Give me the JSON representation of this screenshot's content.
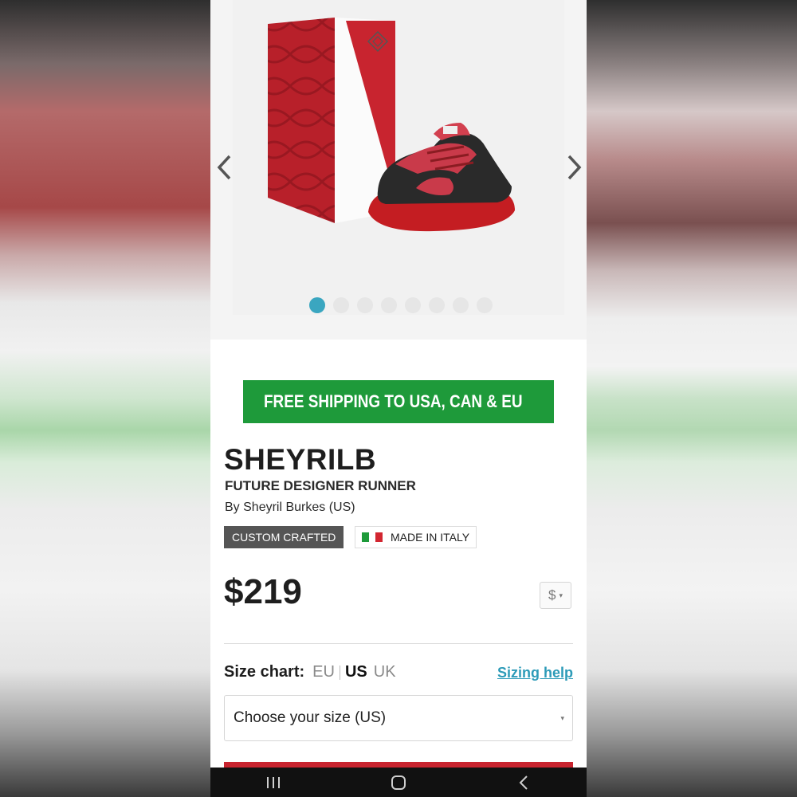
{
  "gallery": {
    "slide_count": 8,
    "active_index": 0,
    "accent_color": "#3aa6c0"
  },
  "shipping_banner": {
    "text": "FREE SHIPPING TO USA, CAN & EU",
    "icon": "airplane-icon",
    "color": "#1e9a3a"
  },
  "product": {
    "name": "SHEYRILB",
    "subtitle": "FUTURE DESIGNER RUNNER",
    "byline": "By Sheyril Burkes (US)",
    "badge_custom": "CUSTOM CRAFTED",
    "badge_origin": "MADE IN ITALY",
    "price": "$219",
    "currency": "$"
  },
  "size": {
    "chart_label": "Size chart:",
    "options": [
      "EU",
      "US",
      "UK"
    ],
    "active_option": "US",
    "help_label": "Sizing help",
    "select_placeholder": "Choose your size (US)"
  },
  "nav": {
    "icons": [
      "recent-apps-icon",
      "home-icon",
      "back-icon"
    ]
  }
}
